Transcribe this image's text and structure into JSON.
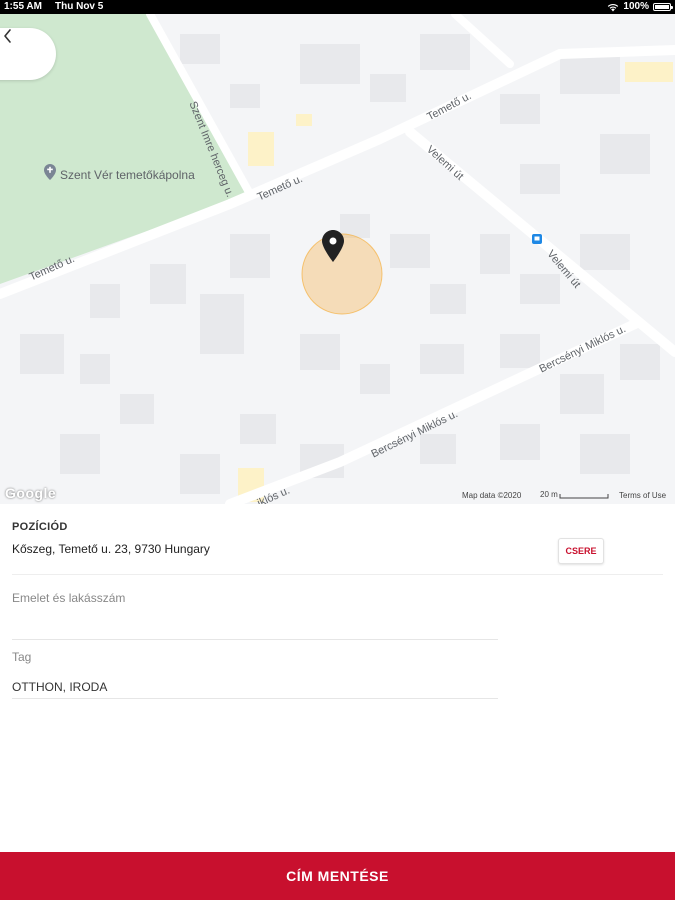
{
  "status_bar": {
    "time": "1:55 AM",
    "date": "Thu Nov 5",
    "battery": "100%"
  },
  "map": {
    "poi_name": "Szent Vér temetőkápolna",
    "streets": {
      "temeto_1": "Temető u.",
      "temeto_2": "Temető u.",
      "temeto_3": "Temető u.",
      "szent_imre": "Szent Imre herceg u.",
      "velemi_1": "Velemi út",
      "velemi_2": "Velemi út",
      "bercsenyi_1": "Bercsényi Miklós u.",
      "bercsenyi_2": "Bercsényi Miklós u.",
      "miklos_fragment": "iklós u."
    },
    "google_logo": "Google",
    "map_data": "Map data ©2020",
    "scale": "20 m",
    "terms": "Terms of Use",
    "colors": {
      "park": "#cfe8cf",
      "road": "#ffffff",
      "building": "#e8e9ec",
      "accuracy": "#f5b041",
      "pin": "#222222"
    }
  },
  "position": {
    "title": "POZÍCIÓD",
    "address": "Kőszeg, Temető u. 23, 9730 Hungary",
    "change_label": "CSERE"
  },
  "fields": {
    "floor_label": "Emelet és lakásszám",
    "floor_value": "",
    "tag_label": "Tag",
    "tag_value": "OTTHON, IRODA"
  },
  "save_button": "CÍM MENTÉSE",
  "accent_color": "#c8102e"
}
